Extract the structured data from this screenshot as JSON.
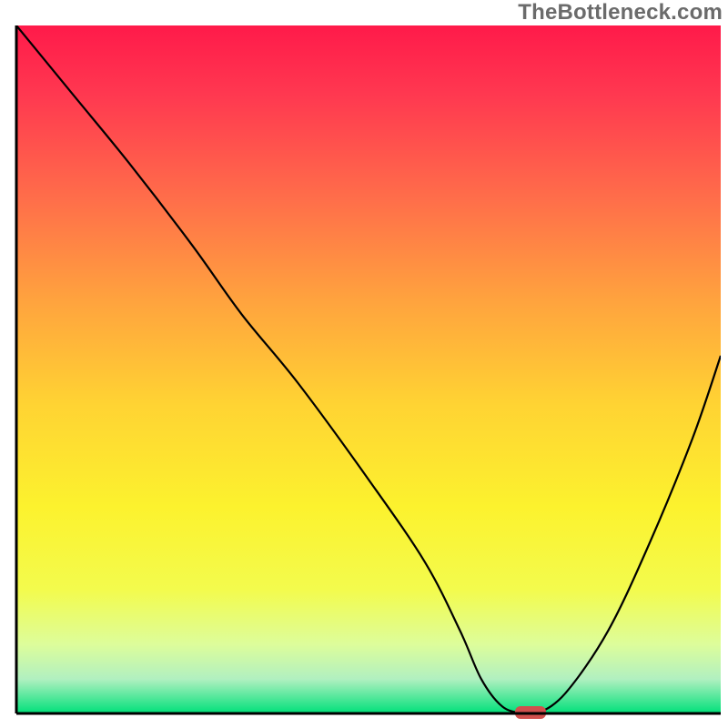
{
  "watermark": "TheBottleneck.com",
  "chart_data": {
    "type": "line",
    "title": "",
    "xlabel": "",
    "ylabel": "",
    "xlim": [
      0,
      100
    ],
    "ylim": [
      0,
      100
    ],
    "background": {
      "type": "vertical-gradient",
      "stops": [
        {
          "pos": 0.0,
          "color": "#ff1a4a"
        },
        {
          "pos": 0.1,
          "color": "#ff3850"
        },
        {
          "pos": 0.25,
          "color": "#ff6d4a"
        },
        {
          "pos": 0.4,
          "color": "#ffa33e"
        },
        {
          "pos": 0.55,
          "color": "#ffd333"
        },
        {
          "pos": 0.7,
          "color": "#fcf22e"
        },
        {
          "pos": 0.82,
          "color": "#f3fb4d"
        },
        {
          "pos": 0.9,
          "color": "#ddfd9b"
        },
        {
          "pos": 0.95,
          "color": "#b1f0c0"
        },
        {
          "pos": 1.0,
          "color": "#00e07a"
        }
      ]
    },
    "series": [
      {
        "name": "bottleneck-curve",
        "x": [
          0,
          8,
          16,
          25,
          32,
          40,
          50,
          58,
          63,
          66,
          69,
          72,
          74,
          78,
          84,
          90,
          96,
          100
        ],
        "y": [
          100,
          90,
          80,
          68,
          58,
          48,
          34,
          22,
          12,
          5,
          1,
          0,
          0,
          3,
          12,
          25,
          40,
          52
        ]
      }
    ],
    "marker": {
      "name": "optimal-point",
      "x": 73,
      "y": 0,
      "color": "#d1504d",
      "shape": "rounded-rect"
    },
    "axis": {
      "color": "#000000",
      "width": 3
    }
  }
}
